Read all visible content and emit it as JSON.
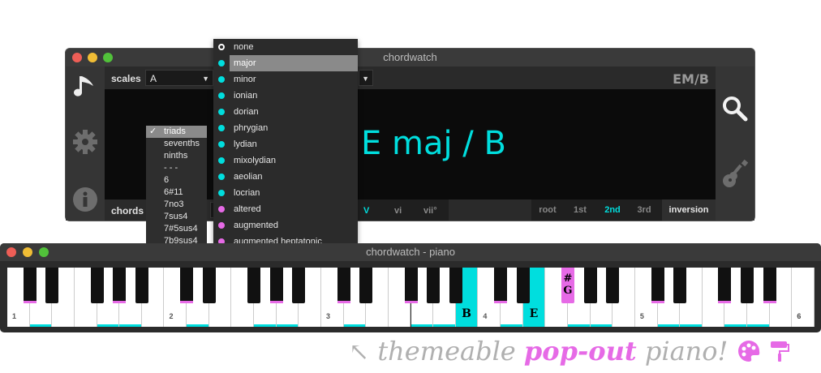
{
  "main_window": {
    "title": "chordwatch",
    "scales_label": "scales",
    "key_value": "A",
    "chord_display": "E maj / B",
    "chord_short": "EM/B",
    "chords_label": "chords",
    "degrees": [
      "V",
      "vi",
      "vii°"
    ],
    "active_degree": "V",
    "inversion": {
      "root": "root",
      "first": "1st",
      "second": "2nd",
      "third": "3rd",
      "label": "inversion",
      "active": "2nd"
    }
  },
  "icons": {
    "music": "music-note-icon",
    "settings": "gear-icon",
    "info": "info-icon",
    "search": "search-icon",
    "guitar": "guitar-icon"
  },
  "chord_type_menu": {
    "items": [
      "triads",
      "sevenths",
      "ninths",
      "- - -",
      "6",
      "6#11",
      "7no3",
      "7sus4",
      "7#5sus4",
      "7b9sus4"
    ],
    "selected": "triads"
  },
  "scale_menu": {
    "items": [
      {
        "label": "none",
        "dot": "hollow"
      },
      {
        "label": "major",
        "dot": "cyan",
        "selected": true
      },
      {
        "label": "minor",
        "dot": "cyan"
      },
      {
        "label": "ionian",
        "dot": "cyan"
      },
      {
        "label": "dorian",
        "dot": "cyan"
      },
      {
        "label": "phrygian",
        "dot": "cyan"
      },
      {
        "label": "lydian",
        "dot": "cyan"
      },
      {
        "label": "mixolydian",
        "dot": "cyan"
      },
      {
        "label": "aeolian",
        "dot": "cyan"
      },
      {
        "label": "locrian",
        "dot": "cyan"
      },
      {
        "label": "altered",
        "dot": "magenta"
      },
      {
        "label": "augmented",
        "dot": "magenta"
      },
      {
        "label": "augmented heptatonic",
        "dot": "magenta"
      }
    ]
  },
  "piano_window": {
    "title": "chordwatch - piano",
    "octave_labels": [
      "1",
      "2",
      "3",
      "4",
      "5",
      "6"
    ],
    "highlighted_notes": [
      "B",
      "E",
      "#G"
    ],
    "tagline_themeable": "themeable",
    "tagline_popout": "pop-out",
    "tagline_piano": "piano!"
  },
  "colors": {
    "accent_cyan": "#00dede",
    "accent_magenta": "#e66ae6",
    "bg_dark": "#2b2b2b"
  }
}
